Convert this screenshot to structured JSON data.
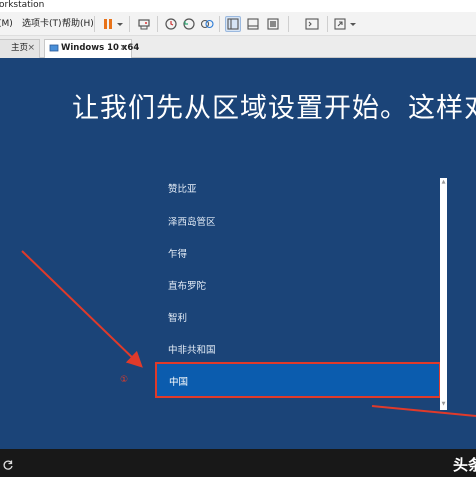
{
  "window": {
    "title": "orkstation"
  },
  "menu": [
    {
      "label": "(M)"
    },
    {
      "label": "选项卡(T)"
    },
    {
      "label": "帮助(H)"
    }
  ],
  "toolbar_icons": [
    "pause-icon",
    "dropdown-icon",
    "send-keys-icon",
    "snapshot-icon",
    "revert-snapshot-icon",
    "snapshot-manager-icon",
    "sidebar-icon",
    "thumbnail-icon",
    "view-icon",
    "console-icon",
    "fullscreen-icon"
  ],
  "tabs": [
    {
      "label": "主页",
      "close": "×"
    },
    {
      "label": "Windows 10 x64",
      "close": "×"
    }
  ],
  "vm": {
    "headline": "让我们先从区域设置开始。这样对",
    "regions": [
      "赞比亚",
      "泽西岛管区",
      "乍得",
      "直布罗陀",
      "智利",
      "中非共和国"
    ],
    "selected_region": "中国",
    "annotation": "①"
  },
  "watermark": "头条",
  "colors": {
    "screen_bg": "#1b4478",
    "selected_bg": "#0b5cae",
    "annotation_red": "#e03a2a"
  }
}
